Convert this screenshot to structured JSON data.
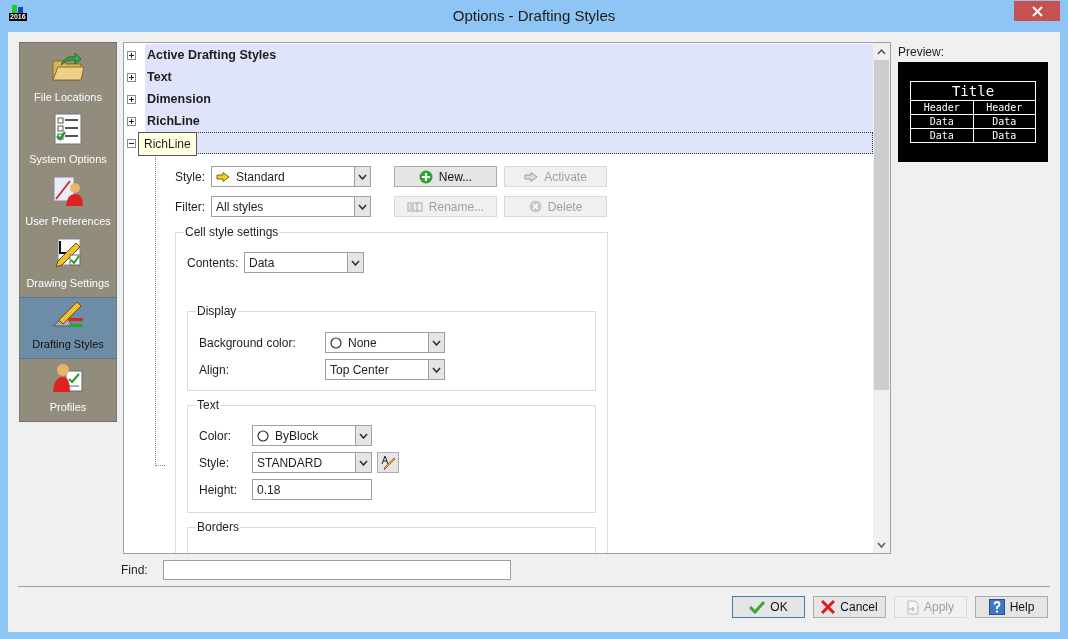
{
  "window": {
    "title": "Options - Drafting Styles",
    "logo_text": "2016"
  },
  "sidebar": {
    "items": [
      {
        "label": "File Locations",
        "selected": false
      },
      {
        "label": "System Options",
        "selected": false
      },
      {
        "label": "User Preferences",
        "selected": false
      },
      {
        "label": "Drawing Settings",
        "selected": false
      },
      {
        "label": "Drafting Styles",
        "selected": true
      },
      {
        "label": "Profiles",
        "selected": false
      }
    ]
  },
  "tree": {
    "nodes": [
      {
        "label": "Active Drafting Styles",
        "expanded": false
      },
      {
        "label": "Text",
        "expanded": false
      },
      {
        "label": "Dimension",
        "expanded": false
      },
      {
        "label": "RichLine",
        "expanded": false
      },
      {
        "expanded": true,
        "tooltip": "RichLine"
      }
    ],
    "style": {
      "label": "Style:",
      "value": "Standard"
    },
    "filter": {
      "label": "Filter:",
      "value": "All styles"
    },
    "buttons": [
      {
        "label": "New...",
        "disabled": false
      },
      {
        "label": "Activate",
        "disabled": true
      },
      {
        "label": "Rename...",
        "disabled": true
      },
      {
        "label": "Delete",
        "disabled": true
      }
    ],
    "cell_style": {
      "title": "Cell style settings",
      "contents": {
        "label": "Contents:",
        "value": "Data"
      },
      "display": {
        "title": "Display",
        "background_color": {
          "label": "Background color:",
          "value": "None"
        },
        "align": {
          "label": "Align:",
          "value": "Top Center"
        }
      },
      "text": {
        "title": "Text",
        "color": {
          "label": "Color:",
          "value": "ByBlock"
        },
        "style": {
          "label": "Style:",
          "value": "STANDARD"
        },
        "height": {
          "label": "Height:",
          "value": "0.18"
        }
      },
      "borders": {
        "title": "Borders"
      }
    }
  },
  "preview": {
    "label": "Preview:",
    "title": "Title",
    "headers": [
      "Header",
      "Header"
    ],
    "rows": [
      [
        "Data",
        "Data"
      ],
      [
        "Data",
        "Data"
      ]
    ]
  },
  "find": {
    "label": "Find:"
  },
  "footer_buttons": [
    {
      "label": "OK",
      "disabled": false,
      "focused": true
    },
    {
      "label": "Cancel",
      "disabled": false,
      "focused": false
    },
    {
      "label": "Apply",
      "disabled": true,
      "focused": false
    },
    {
      "label": "Help",
      "disabled": false,
      "focused": false
    }
  ]
}
